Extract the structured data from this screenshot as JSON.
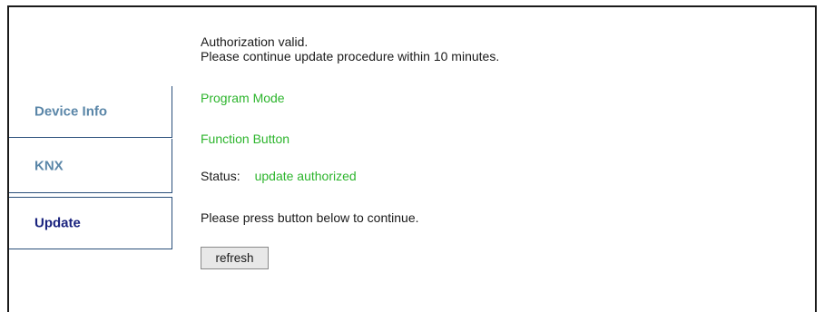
{
  "sidebar": {
    "items": [
      {
        "label": "Device Info",
        "active": false
      },
      {
        "label": "KNX",
        "active": false
      },
      {
        "label": "Update",
        "active": true
      }
    ]
  },
  "main": {
    "auth_line1": "Authorization valid.",
    "auth_line2": "Please continue update procedure within 10 minutes.",
    "program_mode": "Program Mode",
    "function_button": "Function Button",
    "status_label": "Status:",
    "status_value": "update authorized",
    "instruction": "Please press button below to continue.",
    "refresh_label": "refresh"
  },
  "colors": {
    "green": "#2db52d",
    "nav_inactive": "#5a86a8",
    "nav_active": "#1a237e",
    "border": "#2a4f7a"
  }
}
